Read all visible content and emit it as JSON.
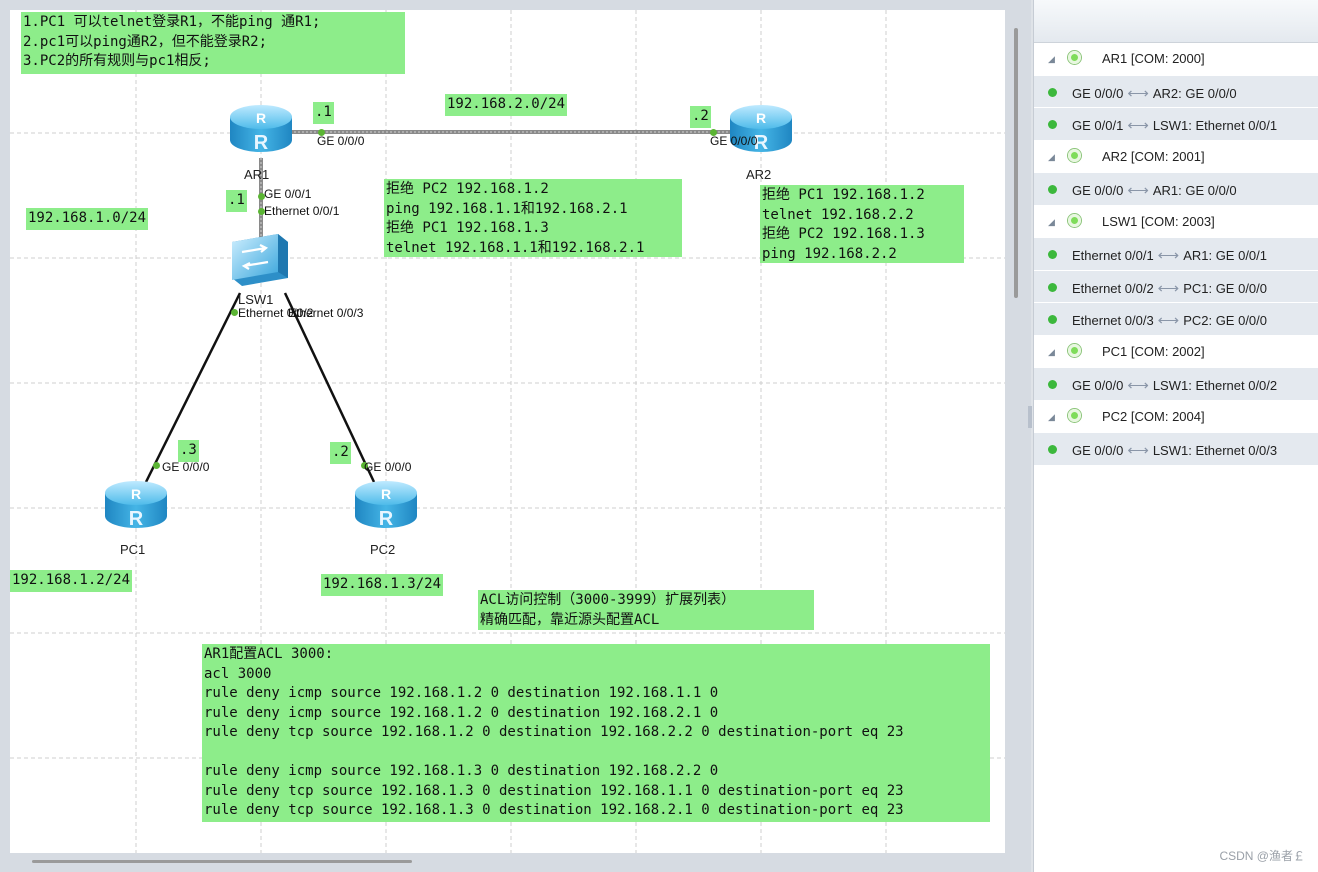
{
  "canvas": {
    "notes": {
      "requirements": "1.PC1 可以telnet登录R1，不能ping 通R1;\n2.pc1可以ping通R2，但不能登录R2;\n3.PC2的所有规则与pc1相反;",
      "net_top": "192.168.2.0/24",
      "net_left": "192.168.1.0/24",
      "ar1_top_ip": ".1",
      "ar2_ip": ".2",
      "ar1_bottom_ip": ".1",
      "pc1_ip_suffix": ".3",
      "pc2_ip_suffix": ".2",
      "mid_rules": "拒绝 PC2 192.168.1.2\nping 192.168.1.1和192.168.2.1\n拒绝 PC1 192.168.1.3\ntelnet 192.168.1.1和192.168.2.1",
      "right_rules": "拒绝 PC1 192.168.1.2\ntelnet 192.168.2.2\n拒绝 PC2 192.168.1.3\nping 192.168.2.2",
      "pc1_address": "192.168.1.2/24",
      "pc2_address": "192.168.1.3/24",
      "acl_title": "ACL访问控制（3000-3999）扩展列表）\n精确匹配，靠近源头配置ACL",
      "acl_config": "AR1配置ACL 3000:\nacl 3000\nrule deny icmp source 192.168.1.2 0 destination 192.168.1.1 0\nrule deny icmp source 192.168.1.2 0 destination 192.168.2.1 0\nrule deny tcp source 192.168.1.2 0 destination 192.168.2.2 0 destination-port eq 23\n\nrule deny icmp source 192.168.1.3 0 destination 192.168.2.2 0\nrule deny tcp source 192.168.1.3 0 destination 192.168.1.1 0 destination-port eq 23\nrule deny tcp source 192.168.1.3 0 destination 192.168.2.1 0 destination-port eq 23"
    },
    "interface_labels": {
      "ar1_ge000": "GE 0/0/0",
      "ar2_ge000": "GE 0/0/0",
      "ar1_ge001": "GE 0/0/1",
      "lsw1_eth001": "Ethernet 0/0/1",
      "lsw1_eth002": "Ethernet 0/0/2",
      "lsw1_eth003": "Ethernet 0/0/3",
      "pc1_ge000": "GE 0/0/0",
      "pc2_ge000": "GE 0/0/0"
    },
    "devices": {
      "ar1": "AR1",
      "ar2": "AR2",
      "lsw1": "LSW1",
      "pc1": "PC1",
      "pc2": "PC2"
    },
    "colors": {
      "note_bg": "#8ded8a",
      "router_blue": "#2aa5dc",
      "link_dot": "#5bb534"
    }
  },
  "panel": {
    "devices": [
      {
        "name": "AR1 [COM: 2000]",
        "links": [
          "GE 0/0/0",
          "AR2: GE 0/0/0",
          "GE 0/0/1",
          "LSW1: Ethernet 0/0/1"
        ]
      },
      {
        "name": "AR2 [COM: 2001]",
        "links": [
          "GE 0/0/0",
          "AR1: GE 0/0/0"
        ]
      },
      {
        "name": "LSW1 [COM: 2003]",
        "links": [
          "Ethernet 0/0/1",
          "AR1: GE 0/0/1",
          "Ethernet 0/0/2",
          "PC1: GE 0/0/0",
          "Ethernet 0/0/3",
          "PC2: GE 0/0/0"
        ]
      },
      {
        "name": "PC1 [COM: 2002]",
        "links": [
          "GE 0/0/0",
          "LSW1: Ethernet 0/0/2"
        ]
      },
      {
        "name": "PC2 [COM: 2004]",
        "links": [
          "GE 0/0/0",
          "LSW1: Ethernet 0/0/3"
        ]
      }
    ],
    "link_arrow": "⟷"
  },
  "watermark": "CSDN @渔者￡"
}
